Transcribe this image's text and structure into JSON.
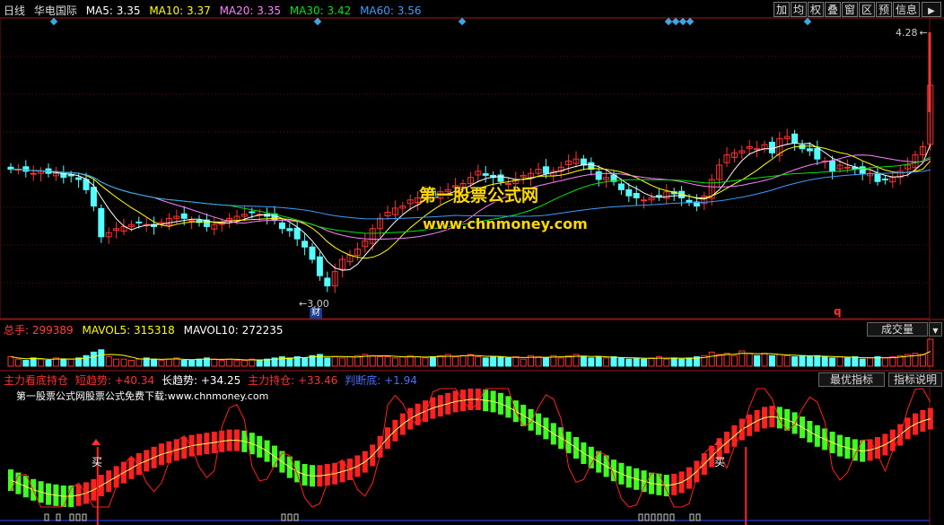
{
  "header": {
    "period": "日线",
    "stock_name": "华电国际",
    "ma5_label": "MA5:",
    "ma5_value": "3.35",
    "ma10_label": "MA10:",
    "ma10_value": "3.37",
    "ma20_label": "MA20:",
    "ma20_value": "3.35",
    "ma30_label": "MA30:",
    "ma30_value": "3.42",
    "ma60_label": "MA60:",
    "ma60_value": "3.56"
  },
  "toolbar": {
    "add": "加",
    "avg": "均",
    "rights": "权",
    "overlay": "叠",
    "window": "窗",
    "range": "区",
    "forecast": "预",
    "info": "信息"
  },
  "price_panel": {
    "high_label": "4.28",
    "low_label": "3.00",
    "fin_badge": "财",
    "q_marker": "q",
    "watermark_cn": "第一股票公式网",
    "watermark_url": "www.chnmoney.com"
  },
  "volume_panel": {
    "total_label": "总手:",
    "total_value": "299389",
    "mavol5_label": "MAVOL5:",
    "mavol5_value": "315318",
    "mavol10_label": "MAVOL10:",
    "mavol10_value": "272235",
    "volume_button": "成交量"
  },
  "indicator_panel": {
    "l1_label": "主力看底持仓",
    "l2_label": "短趋势:",
    "l2_value": "+40.34",
    "l3_label": "长趋势:",
    "l3_value": "+34.25",
    "l4_label": "主力持仓:",
    "l4_value": "+33.46",
    "l5_label": "判断底:",
    "l5_value": "+1.94",
    "subtitle": "第一股票公式网股票公式免费下载:www.chnmoney.com",
    "buy_label": "买",
    "best_button": "最优指标",
    "explain_button": "指标说明"
  },
  "colors": {
    "up": "#ff3232",
    "down": "#54ffff",
    "ma5": "#ffffff",
    "ma10": "#ffff00",
    "ma20": "#ff80ff",
    "ma30": "#00e600",
    "ma60": "#3c9cff",
    "ind_up": "#ff2020",
    "ind_down": "#40ff20"
  },
  "chart_data": {
    "type": "candlestick",
    "x_unit": "trading day index",
    "ylim": [
      3.0,
      4.28
    ],
    "y_labels": [
      "4.28",
      "3.00"
    ],
    "closes": [
      3.62,
      3.62,
      3.61,
      3.6,
      3.61,
      3.6,
      3.6,
      3.58,
      3.59,
      3.57,
      3.52,
      3.44,
      3.29,
      3.31,
      3.33,
      3.34,
      3.35,
      3.36,
      3.35,
      3.34,
      3.36,
      3.38,
      3.39,
      3.38,
      3.37,
      3.36,
      3.34,
      3.35,
      3.36,
      3.38,
      3.39,
      3.4,
      3.41,
      3.4,
      3.39,
      3.37,
      3.33,
      3.32,
      3.28,
      3.24,
      3.18,
      3.1,
      3.05,
      3.12,
      3.18,
      3.2,
      3.23,
      3.27,
      3.33,
      3.38,
      3.41,
      3.43,
      3.44,
      3.47,
      3.48,
      3.5,
      3.49,
      3.51,
      3.52,
      3.54,
      3.55,
      3.58,
      3.61,
      3.59,
      3.58,
      3.56,
      3.55,
      3.57,
      3.59,
      3.6,
      3.62,
      3.6,
      3.61,
      3.63,
      3.66,
      3.67,
      3.64,
      3.62,
      3.57,
      3.58,
      3.56,
      3.52,
      3.49,
      3.48,
      3.47,
      3.48,
      3.49,
      3.51,
      3.5,
      3.48,
      3.46,
      3.44,
      3.49,
      3.57,
      3.64,
      3.69,
      3.7,
      3.71,
      3.73,
      3.72,
      3.74,
      3.7,
      3.77,
      3.78,
      3.75,
      3.72,
      3.71,
      3.67,
      3.66,
      3.61,
      3.64,
      3.63,
      3.62,
      3.6,
      3.6,
      3.56,
      3.57,
      3.58,
      3.61,
      3.64,
      3.69,
      3.73,
      4.03
    ],
    "volume": [
      0.8,
      0.6,
      0.5,
      0.7,
      0.6,
      0.5,
      0.7,
      0.6,
      0.6,
      0.7,
      0.9,
      1.2,
      1.4,
      0.8,
      0.6,
      0.6,
      0.5,
      0.6,
      0.7,
      0.6,
      0.5,
      0.6,
      0.7,
      0.5,
      0.5,
      0.6,
      0.7,
      0.6,
      0.5,
      0.6,
      0.5,
      0.5,
      0.6,
      0.5,
      0.6,
      0.7,
      0.8,
      0.7,
      0.8,
      0.7,
      0.9,
      1.0,
      0.7,
      0.8,
      0.7,
      0.8,
      0.9,
      1.0,
      0.9,
      0.8,
      0.8,
      0.7,
      0.8,
      0.9,
      0.8,
      0.7,
      0.8,
      0.9,
      1.0,
      0.8,
      0.9,
      1.0,
      0.8,
      0.7,
      0.8,
      0.8,
      0.7,
      0.8,
      0.6,
      0.9,
      0.8,
      0.7,
      0.9,
      0.7,
      0.9,
      1.0,
      0.8,
      0.7,
      0.8,
      0.7,
      0.8,
      0.7,
      0.6,
      0.7,
      0.6,
      0.7,
      0.8,
      0.6,
      0.7,
      0.6,
      0.7,
      0.8,
      0.9,
      1.2,
      1.0,
      1.1,
      0.9,
      1.3,
      1.1,
      0.9,
      1.1,
      0.9,
      1.0,
      0.9,
      0.8,
      0.9,
      0.8,
      0.9,
      0.8,
      0.7,
      0.8,
      0.7,
      0.8,
      0.6,
      0.7,
      0.8,
      0.7,
      0.8,
      0.9,
      1.0,
      1.1,
      1.0,
      2.3
    ],
    "ma_series": [
      {
        "name": "MA5",
        "value": 3.35
      },
      {
        "name": "MA10",
        "value": 3.37
      },
      {
        "name": "MA20",
        "value": 3.35
      },
      {
        "name": "MA30",
        "value": 3.42
      },
      {
        "name": "MA60",
        "value": 3.56
      }
    ],
    "indicator": {
      "hist": [
        25,
        22,
        19,
        16,
        14,
        12,
        11,
        10,
        10,
        11,
        13,
        16,
        20,
        24,
        28,
        32,
        36,
        40,
        43,
        46,
        49,
        51,
        53,
        55,
        57,
        58,
        59,
        60,
        61,
        62,
        62,
        61,
        59,
        56,
        52,
        47,
        42,
        37,
        33,
        30,
        29,
        29,
        30,
        31,
        33,
        35,
        38,
        42,
        48,
        56,
        64,
        71,
        77,
        82,
        86,
        89,
        92,
        94,
        96,
        98,
        99,
        100,
        100,
        99,
        98,
        96,
        93,
        89,
        85,
        81,
        77,
        73,
        68,
        64,
        60,
        55,
        50,
        46,
        42,
        38,
        34,
        31,
        28,
        26,
        24,
        22,
        21,
        20,
        21,
        23,
        27,
        33,
        40,
        47,
        54,
        60,
        66,
        72,
        76,
        80,
        83,
        84,
        83,
        81,
        78,
        74,
        70,
        66,
        63,
        60,
        57,
        55,
        53,
        52,
        53,
        55,
        58,
        62,
        67,
        73,
        77,
        80,
        82
      ],
      "up_flags": [
        0,
        0,
        0,
        0,
        0,
        0,
        0,
        0,
        0,
        1,
        1,
        1,
        1,
        1,
        1,
        1,
        1,
        1,
        1,
        1,
        1,
        1,
        1,
        1,
        1,
        1,
        1,
        1,
        1,
        1,
        1,
        0,
        0,
        0,
        0,
        0,
        0,
        0,
        0,
        0,
        0,
        1,
        1,
        1,
        1,
        1,
        1,
        1,
        1,
        1,
        1,
        1,
        1,
        1,
        1,
        1,
        1,
        1,
        1,
        1,
        1,
        1,
        1,
        0,
        0,
        0,
        0,
        0,
        0,
        0,
        0,
        0,
        0,
        0,
        0,
        0,
        0,
        0,
        0,
        0,
        0,
        0,
        0,
        0,
        0,
        0,
        0,
        0,
        1,
        1,
        1,
        1,
        1,
        1,
        1,
        1,
        1,
        1,
        1,
        1,
        1,
        1,
        0,
        0,
        0,
        0,
        0,
        0,
        0,
        0,
        0,
        0,
        0,
        0,
        1,
        1,
        1,
        1,
        1,
        1,
        1,
        1,
        1
      ],
      "buy_signal_days": [
        12,
        98
      ]
    }
  }
}
